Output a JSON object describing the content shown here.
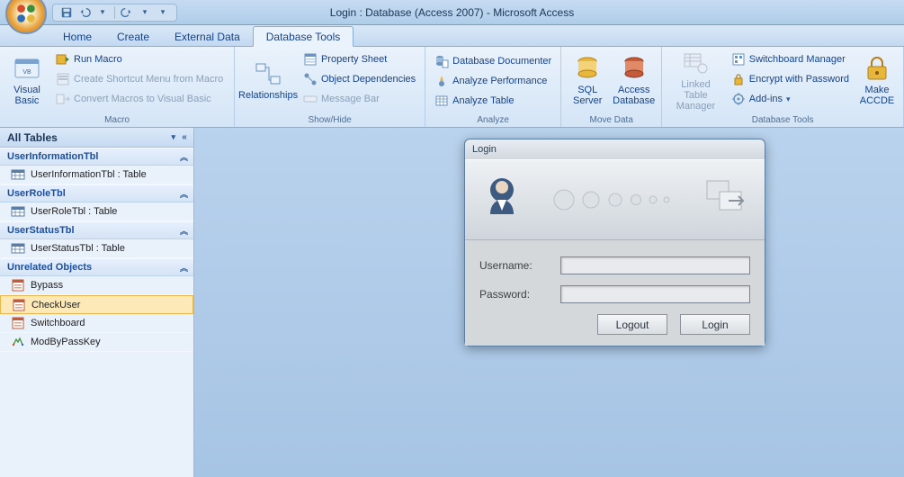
{
  "titlebar": {
    "title": "Login : Database (Access 2007) - Microsoft Access"
  },
  "tabs": {
    "home": "Home",
    "create": "Create",
    "external": "External Data",
    "dbtools": "Database Tools"
  },
  "ribbon": {
    "macro": {
      "visual_basic": "Visual\nBasic",
      "run_macro": "Run Macro",
      "create_shortcut": "Create Shortcut Menu from Macro",
      "convert_macros": "Convert Macros to Visual Basic",
      "group_label": "Macro"
    },
    "showhide": {
      "relationships": "Relationships",
      "property_sheet": "Property Sheet",
      "object_deps": "Object Dependencies",
      "message_bar": "Message Bar",
      "group_label": "Show/Hide"
    },
    "analyze": {
      "db_documenter": "Database Documenter",
      "analyze_perf": "Analyze Performance",
      "analyze_table": "Analyze Table",
      "group_label": "Analyze"
    },
    "movedata": {
      "sql_server": "SQL\nServer",
      "access_db": "Access\nDatabase",
      "group_label": "Move Data"
    },
    "dbtools": {
      "linked_table": "Linked Table\nManager",
      "switchboard_mgr": "Switchboard Manager",
      "encrypt": "Encrypt with Password",
      "addins": "Add-ins",
      "make_accde": "Make\nACCDE",
      "group_label": "Database Tools"
    }
  },
  "nav": {
    "header": "All Tables",
    "groups": [
      {
        "name": "UserInformationTbl",
        "items": [
          "UserInformationTbl : Table"
        ]
      },
      {
        "name": "UserRoleTbl",
        "items": [
          "UserRoleTbl : Table"
        ]
      },
      {
        "name": "UserStatusTbl",
        "items": [
          "UserStatusTbl : Table"
        ]
      },
      {
        "name": "Unrelated Objects",
        "items": [
          "Bypass",
          "CheckUser",
          "Switchboard",
          "ModByPassKey"
        ]
      }
    ]
  },
  "form": {
    "title": "Login",
    "username_label": "Username:",
    "password_label": "Password:",
    "logout_btn": "Logout",
    "login_btn": "Login"
  }
}
